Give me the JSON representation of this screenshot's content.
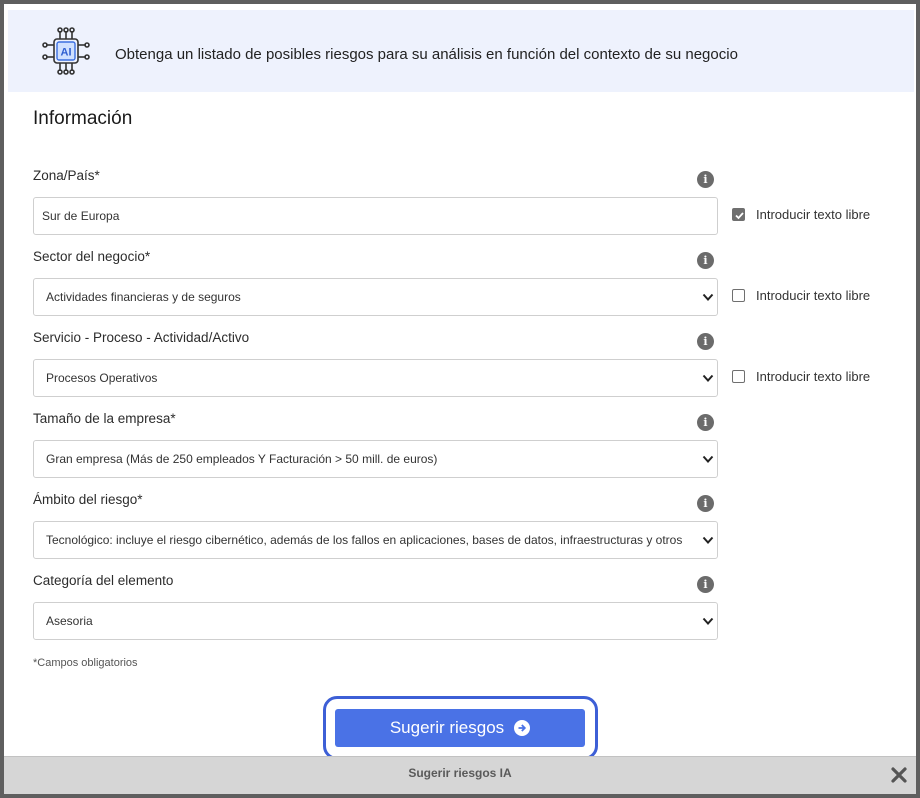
{
  "banner": {
    "icon": "ai-chip-icon",
    "text": "Obtenga un listado de posibles riesgos para su análisis en función del contexto de su negocio"
  },
  "section": {
    "title": "Información"
  },
  "fields": {
    "zona": {
      "label": "Zona/País*",
      "value": "Sur de Europa",
      "free_text_label": "Introducir texto libre",
      "free_text_checked": true
    },
    "sector": {
      "label": "Sector del negocio*",
      "value": "Actividades financieras y de seguros",
      "free_text_label": "Introducir texto libre",
      "free_text_checked": false
    },
    "servicio": {
      "label": "Servicio - Proceso - Actividad/Activo",
      "value": "Procesos Operativos",
      "free_text_label": "Introducir texto libre",
      "free_text_checked": false
    },
    "tamano": {
      "label": "Tamaño de la empresa*",
      "value": "Gran empresa (Más de 250 empleados Y Facturación > 50 mill. de euros)"
    },
    "ambito": {
      "label": "Ámbito del riesgo*",
      "value": "Tecnológico: incluye el riesgo cibernético, además de los fallos en aplicaciones, bases de datos, infraestructuras y otros"
    },
    "categoria": {
      "label": "Categoría del elemento",
      "value": "Asesoria"
    }
  },
  "required_note": "*Campos obligatorios",
  "suggest_button": {
    "label": "Sugerir riesgos"
  },
  "footer": {
    "title": "Sugerir riesgos IA"
  },
  "colors": {
    "accent": "#4a72e6",
    "banner_bg": "#eef2fd",
    "highlight": "#3d5fd6"
  }
}
